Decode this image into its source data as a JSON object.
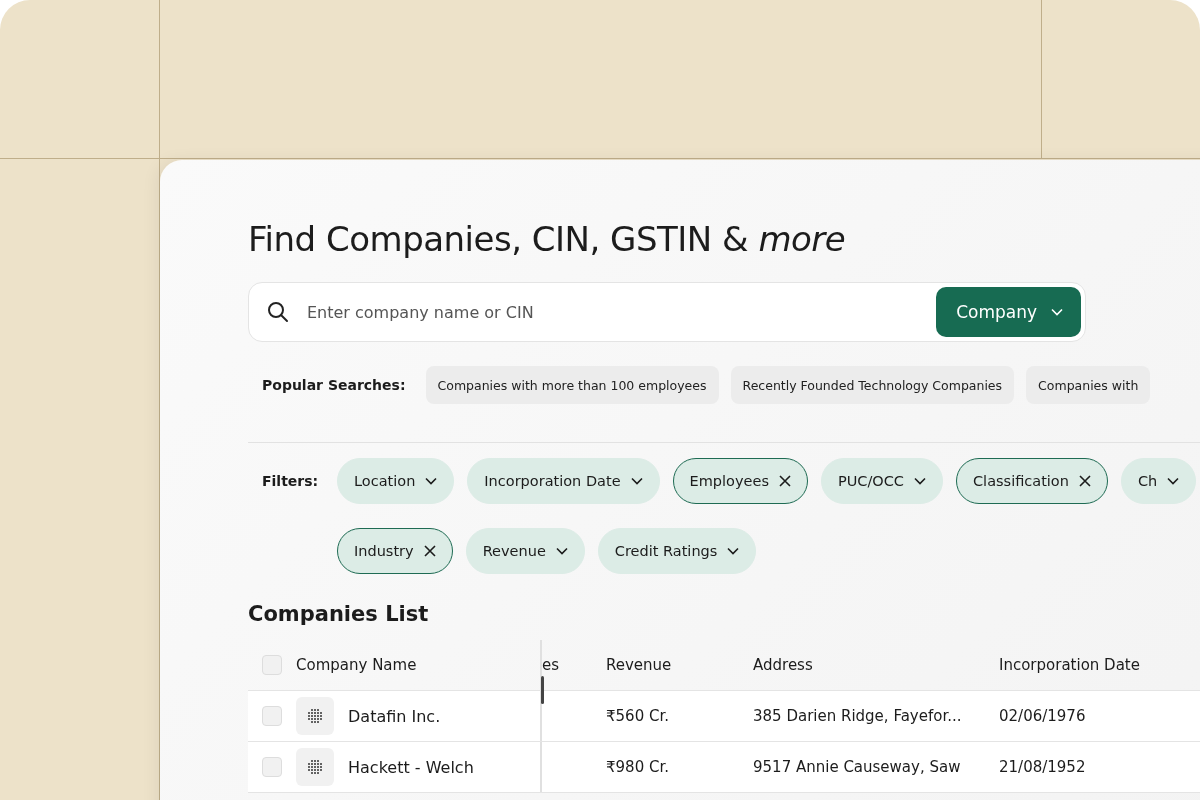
{
  "title": "Find Companies, CIN, GSTIN & *more*",
  "search": {
    "placeholder": "Enter company name or CIN",
    "type_button": "Company"
  },
  "popular_searches": {
    "label": "Popular Searches:",
    "items": [
      "Companies with more than 100 employees",
      "Recently Founded Technology Companies",
      "Companies with"
    ]
  },
  "filters": {
    "label": "Filters:",
    "rows": [
      [
        {
          "label": "Location",
          "active": false
        },
        {
          "label": "Incorporation Date",
          "active": false
        },
        {
          "label": "Employees",
          "active": true
        },
        {
          "label": "PUC/OCC",
          "active": false
        },
        {
          "label": "Classification",
          "active": true
        },
        {
          "label": "Ch",
          "active": false
        }
      ],
      [
        {
          "label": "Industry",
          "active": true
        },
        {
          "label": "Revenue",
          "active": false
        },
        {
          "label": "Credit Ratings",
          "active": false
        }
      ]
    ]
  },
  "companies_list": {
    "heading": "Companies List",
    "table": {
      "select_all_checked": false,
      "columns": [
        "Company Name",
        "es",
        "Revenue",
        "Address",
        "Incorporation Date"
      ],
      "rows": [
        {
          "checked": false,
          "name": "Datafin Inc.",
          "revenue": "₹560 Cr.",
          "address": "385 Darien Ridge, Fayefor...",
          "incorporation_date": "02/06/1976"
        },
        {
          "checked": false,
          "name": "Hackett - Welch",
          "revenue": "₹980 Cr.",
          "address": "9517 Annie Causeway, Saw",
          "incorporation_date": "21/08/1952"
        }
      ]
    }
  }
}
